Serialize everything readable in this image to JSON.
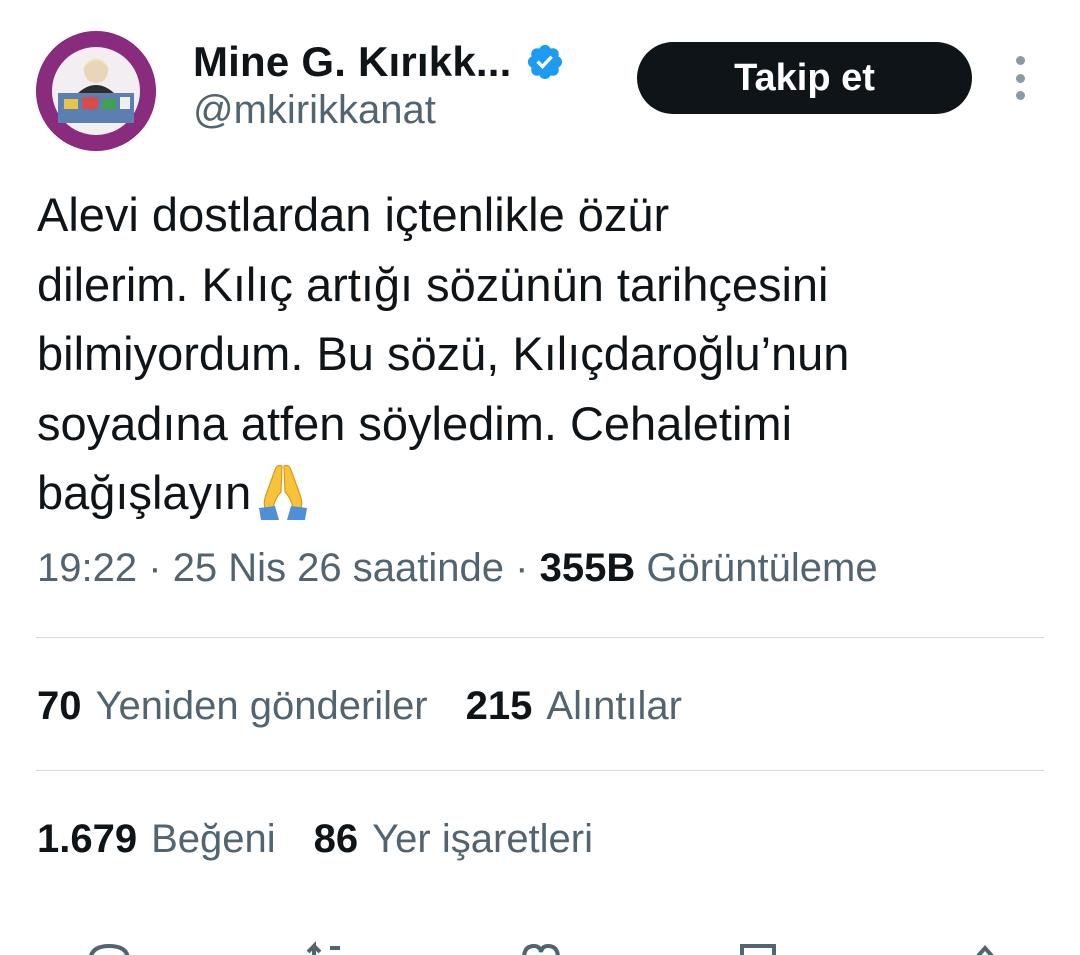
{
  "author": {
    "display_name": "Mine G. Kırıkk...",
    "handle": "@mkirikkanat",
    "verified": true,
    "avatar_icon": "profile-avatar"
  },
  "follow_button_label": "Takip et",
  "tweet_text_lines": [
    "Alevi dostlardan içtenlikle özür",
    "dilerim. Kılıç artığı sözünün tarihçesini",
    "bilmiyordum. Bu sözü, Kılıçdaroğlu’nun",
    "soyadına atfen söyledim. Cehaletimi",
    "bağışlayın"
  ],
  "tweet_emoji": "folded-hands-emoji",
  "meta": {
    "time": "19:22",
    "separator": "·",
    "date": "25 Nis 26 saatinde",
    "views_count": "355B",
    "views_label": "Görüntüleme"
  },
  "stats_row1": [
    {
      "count": "70",
      "label": "Yeniden gönderiler"
    },
    {
      "count": "215",
      "label": "Alıntılar"
    }
  ],
  "stats_row2": [
    {
      "count": "1.679",
      "label": "Beğeni"
    },
    {
      "count": "86",
      "label": "Yer işaretleri"
    }
  ],
  "action_icons": [
    "reply-icon",
    "retweet-icon",
    "like-icon",
    "bookmark-icon",
    "share-icon"
  ],
  "colors": {
    "text_primary": "#0f1419",
    "text_secondary": "#536471",
    "divider": "#cfd9de",
    "verified_blue": "#1d9bf0",
    "button_bg": "#0f1419",
    "button_text": "#ffffff"
  }
}
